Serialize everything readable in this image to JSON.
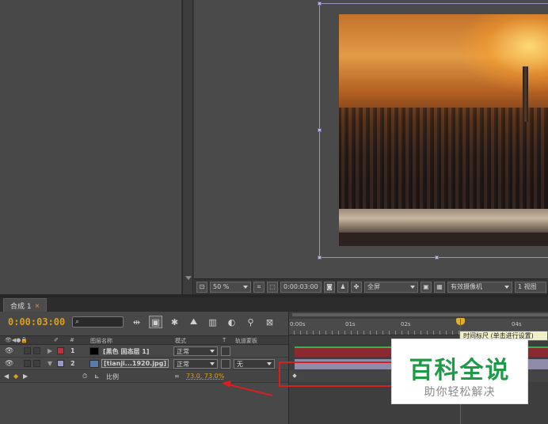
{
  "viewer_toolbar": {
    "zoom": "50 %",
    "timecode": "0:00:03:00",
    "resolution": "全屏",
    "camera": "有效摄像机",
    "views": "1 视图"
  },
  "composition": {
    "tab_label": "合成 1",
    "tab_close": "×"
  },
  "timeline": {
    "timecode": "0:00:03:00",
    "columns": {
      "number": "#",
      "layer_name": "图层名称",
      "mode": "模式",
      "t": "T",
      "track_matte": "轨道蒙板"
    },
    "ruler": {
      "labels": [
        "0:00s",
        "01s",
        "02s",
        "",
        "04s"
      ],
      "label_times": [
        0,
        1,
        2,
        3,
        4
      ],
      "duration": 4.6,
      "playhead_time": 3
    },
    "tooltip": "时间标尺 (单击进行设置)",
    "layers": [
      {
        "index": "1",
        "name": "[黑色 固态层 1]",
        "mode": "正常",
        "track_matte": "",
        "label_color": "#c0303a",
        "thumb_color": "#000000"
      },
      {
        "index": "2",
        "name": "[tianji...1920.jpg]",
        "mode": "正常",
        "track_matte": "无",
        "label_color": "#9a98c8",
        "thumb_color": "#5a7aa8"
      }
    ],
    "property": {
      "name": "比例",
      "value": "73.0, 73.0%"
    }
  },
  "watermark": {
    "title": "百科全说",
    "subtitle": "助你轻松解决"
  },
  "colors": {
    "accent_timecode": "#d9a020",
    "playhead": "#d43030",
    "annotation": "#d62020",
    "watermark_green": "#1f9a46"
  }
}
